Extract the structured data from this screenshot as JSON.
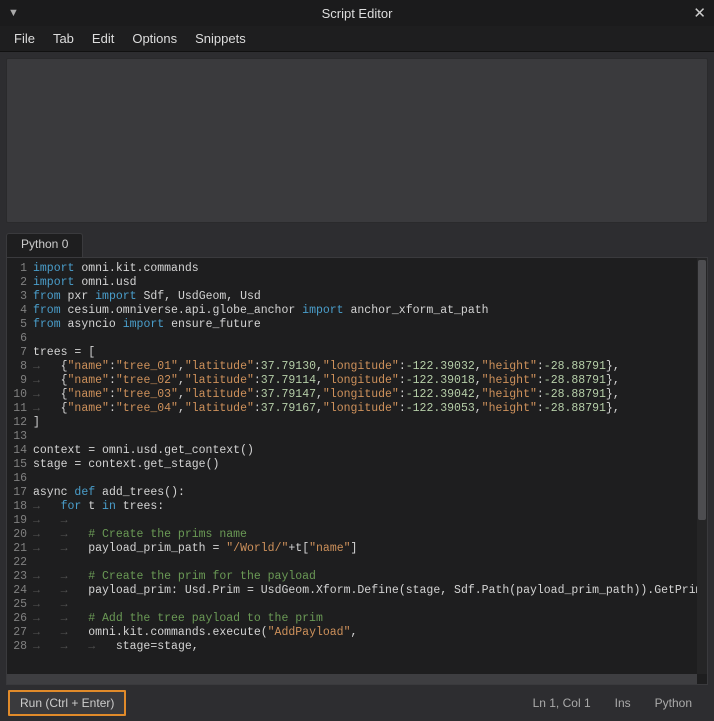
{
  "window": {
    "title": "Script Editor"
  },
  "menu": {
    "items": [
      "File",
      "Tab",
      "Edit",
      "Options",
      "Snippets"
    ]
  },
  "tabs": {
    "active": "Python 0"
  },
  "editor": {
    "lines": [
      {
        "n": 1,
        "tokens": [
          [
            "kw",
            "import"
          ],
          [
            "ws",
            "·"
          ],
          [
            "ident",
            "omni.kit.commands"
          ]
        ]
      },
      {
        "n": 2,
        "tokens": [
          [
            "kw",
            "import"
          ],
          [
            "ws",
            "·"
          ],
          [
            "ident",
            "omni.usd"
          ]
        ]
      },
      {
        "n": 3,
        "tokens": [
          [
            "kw",
            "from"
          ],
          [
            "ws",
            "·"
          ],
          [
            "ident",
            "pxr"
          ],
          [
            "ws",
            "·"
          ],
          [
            "kw",
            "import"
          ],
          [
            "ws",
            "·"
          ],
          [
            "ident",
            "Sdf,"
          ],
          [
            "ws",
            "·"
          ],
          [
            "ident",
            "UsdGeom,"
          ],
          [
            "ws",
            "·"
          ],
          [
            "ident",
            "Usd"
          ]
        ]
      },
      {
        "n": 4,
        "tokens": [
          [
            "kw",
            "from"
          ],
          [
            "ws",
            "·"
          ],
          [
            "ident",
            "cesium.omniverse.api.globe_anchor"
          ],
          [
            "ws",
            "·"
          ],
          [
            "kw",
            "import"
          ],
          [
            "ws",
            "·"
          ],
          [
            "ident",
            "anchor_xform_at_path"
          ]
        ]
      },
      {
        "n": 5,
        "tokens": [
          [
            "kw",
            "from"
          ],
          [
            "ws",
            "·"
          ],
          [
            "ident",
            "asyncio"
          ],
          [
            "ws",
            "·"
          ],
          [
            "kw",
            "import"
          ],
          [
            "ws",
            "·"
          ],
          [
            "ident",
            "ensure_future"
          ]
        ]
      },
      {
        "n": 6,
        "tokens": []
      },
      {
        "n": 7,
        "tokens": [
          [
            "ident",
            "trees"
          ],
          [
            "ws",
            "·"
          ],
          [
            "punc",
            "="
          ],
          [
            "ws",
            "·"
          ],
          [
            "punc",
            "["
          ]
        ]
      },
      {
        "n": 8,
        "tokens": [
          [
            "ws",
            "→"
          ],
          [
            "punc",
            "{"
          ],
          [
            "str",
            "\"name\""
          ],
          [
            "punc",
            ":"
          ],
          [
            "str",
            "\"tree_01\""
          ],
          [
            "punc",
            ","
          ],
          [
            "str",
            "\"latitude\""
          ],
          [
            "punc",
            ":"
          ],
          [
            "num",
            "37.79130"
          ],
          [
            "punc",
            ","
          ],
          [
            "str",
            "\"longitude\""
          ],
          [
            "punc",
            ":"
          ],
          [
            "num",
            "-122.39032"
          ],
          [
            "punc",
            ","
          ],
          [
            "str",
            "\"height\""
          ],
          [
            "punc",
            ":"
          ],
          [
            "num",
            "-28.88791"
          ],
          [
            "punc",
            "},"
          ]
        ]
      },
      {
        "n": 9,
        "tokens": [
          [
            "ws",
            "→"
          ],
          [
            "punc",
            "{"
          ],
          [
            "str",
            "\"name\""
          ],
          [
            "punc",
            ":"
          ],
          [
            "str",
            "\"tree_02\""
          ],
          [
            "punc",
            ","
          ],
          [
            "str",
            "\"latitude\""
          ],
          [
            "punc",
            ":"
          ],
          [
            "num",
            "37.79114"
          ],
          [
            "punc",
            ","
          ],
          [
            "str",
            "\"longitude\""
          ],
          [
            "punc",
            ":"
          ],
          [
            "num",
            "-122.39018"
          ],
          [
            "punc",
            ","
          ],
          [
            "str",
            "\"height\""
          ],
          [
            "punc",
            ":"
          ],
          [
            "num",
            "-28.88791"
          ],
          [
            "punc",
            "},"
          ]
        ]
      },
      {
        "n": 10,
        "tokens": [
          [
            "ws",
            "→"
          ],
          [
            "punc",
            "{"
          ],
          [
            "str",
            "\"name\""
          ],
          [
            "punc",
            ":"
          ],
          [
            "str",
            "\"tree_03\""
          ],
          [
            "punc",
            ","
          ],
          [
            "str",
            "\"latitude\""
          ],
          [
            "punc",
            ":"
          ],
          [
            "num",
            "37.79147"
          ],
          [
            "punc",
            ","
          ],
          [
            "str",
            "\"longitude\""
          ],
          [
            "punc",
            ":"
          ],
          [
            "num",
            "-122.39042"
          ],
          [
            "punc",
            ","
          ],
          [
            "str",
            "\"height\""
          ],
          [
            "punc",
            ":"
          ],
          [
            "num",
            "-28.88791"
          ],
          [
            "punc",
            "},"
          ]
        ]
      },
      {
        "n": 11,
        "tokens": [
          [
            "ws",
            "→"
          ],
          [
            "punc",
            "{"
          ],
          [
            "str",
            "\"name\""
          ],
          [
            "punc",
            ":"
          ],
          [
            "str",
            "\"tree_04\""
          ],
          [
            "punc",
            ","
          ],
          [
            "str",
            "\"latitude\""
          ],
          [
            "punc",
            ":"
          ],
          [
            "num",
            "37.79167"
          ],
          [
            "punc",
            ","
          ],
          [
            "str",
            "\"longitude\""
          ],
          [
            "punc",
            ":"
          ],
          [
            "num",
            "-122.39053"
          ],
          [
            "punc",
            ","
          ],
          [
            "str",
            "\"height\""
          ],
          [
            "punc",
            ":"
          ],
          [
            "num",
            "-28.88791"
          ],
          [
            "punc",
            "},"
          ]
        ]
      },
      {
        "n": 12,
        "tokens": [
          [
            "punc",
            "]"
          ]
        ]
      },
      {
        "n": 13,
        "tokens": []
      },
      {
        "n": 14,
        "tokens": [
          [
            "ident",
            "context"
          ],
          [
            "ws",
            "·"
          ],
          [
            "punc",
            "="
          ],
          [
            "ws",
            "·"
          ],
          [
            "ident",
            "omni.usd.get_context"
          ],
          [
            "punc",
            "()"
          ]
        ]
      },
      {
        "n": 15,
        "tokens": [
          [
            "ident",
            "stage"
          ],
          [
            "ws",
            "·"
          ],
          [
            "punc",
            "="
          ],
          [
            "ws",
            "·"
          ],
          [
            "ident",
            "context.get_stage"
          ],
          [
            "punc",
            "()"
          ]
        ]
      },
      {
        "n": 16,
        "tokens": []
      },
      {
        "n": 17,
        "tokens": [
          [
            "ident",
            "async"
          ],
          [
            "ws",
            "·"
          ],
          [
            "kw",
            "def"
          ],
          [
            "ws",
            "·"
          ],
          [
            "ident",
            "add_trees"
          ],
          [
            "punc",
            "():"
          ]
        ]
      },
      {
        "n": 18,
        "tokens": [
          [
            "ws",
            "→"
          ],
          [
            "kw",
            "for"
          ],
          [
            "ws",
            "·"
          ],
          [
            "ident",
            "t"
          ],
          [
            "ws",
            "·"
          ],
          [
            "kw",
            "in"
          ],
          [
            "ws",
            "·"
          ],
          [
            "ident",
            "trees"
          ],
          [
            "punc",
            ":"
          ]
        ]
      },
      {
        "n": 19,
        "tokens": [
          [
            "ws",
            "→→"
          ]
        ]
      },
      {
        "n": 20,
        "tokens": [
          [
            "ws",
            "→→"
          ],
          [
            "cmt",
            "#·Create·the·prims·name"
          ]
        ]
      },
      {
        "n": 21,
        "tokens": [
          [
            "ws",
            "→→"
          ],
          [
            "ident",
            "payload_prim_path"
          ],
          [
            "ws",
            "·"
          ],
          [
            "punc",
            "="
          ],
          [
            "ws",
            "·"
          ],
          [
            "str",
            "\"/World/\""
          ],
          [
            "punc",
            "+"
          ],
          [
            "ident",
            "t["
          ],
          [
            "str",
            "\"name\""
          ],
          [
            "punc",
            "]"
          ]
        ]
      },
      {
        "n": 22,
        "tokens": []
      },
      {
        "n": 23,
        "tokens": [
          [
            "ws",
            "→→"
          ],
          [
            "cmt",
            "#·Create·the·prim·for·the·payload"
          ]
        ]
      },
      {
        "n": 24,
        "tokens": [
          [
            "ws",
            "→→"
          ],
          [
            "ident",
            "payload_prim:"
          ],
          [
            "ws",
            "·"
          ],
          [
            "ident",
            "Usd.Prim"
          ],
          [
            "ws",
            "·"
          ],
          [
            "punc",
            "="
          ],
          [
            "ws",
            "·"
          ],
          [
            "ident",
            "UsdGeom.Xform.Define"
          ],
          [
            "punc",
            "("
          ],
          [
            "ident",
            "stage,"
          ],
          [
            "ws",
            "·"
          ],
          [
            "ident",
            "Sdf.Path"
          ],
          [
            "punc",
            "("
          ],
          [
            "ident",
            "payload_prim_path"
          ],
          [
            "punc",
            ")).GetPrim()"
          ]
        ]
      },
      {
        "n": 25,
        "tokens": [
          [
            "ws",
            "→→"
          ]
        ]
      },
      {
        "n": 26,
        "tokens": [
          [
            "ws",
            "→→"
          ],
          [
            "cmt",
            "#·Add·the·tree·payload·to·the·prim"
          ]
        ]
      },
      {
        "n": 27,
        "tokens": [
          [
            "ws",
            "→→"
          ],
          [
            "ident",
            "omni.kit.commands.execute"
          ],
          [
            "punc",
            "("
          ],
          [
            "str",
            "\"AddPayload\""
          ],
          [
            "punc",
            ","
          ]
        ]
      },
      {
        "n": 28,
        "tokens": [
          [
            "ws",
            "→→→"
          ],
          [
            "ident",
            "stage=stage,"
          ]
        ]
      }
    ]
  },
  "footer": {
    "run_label": "Run (Ctrl + Enter)",
    "position": "Ln 1, Col 1",
    "mode": "Ins",
    "lang": "Python"
  }
}
